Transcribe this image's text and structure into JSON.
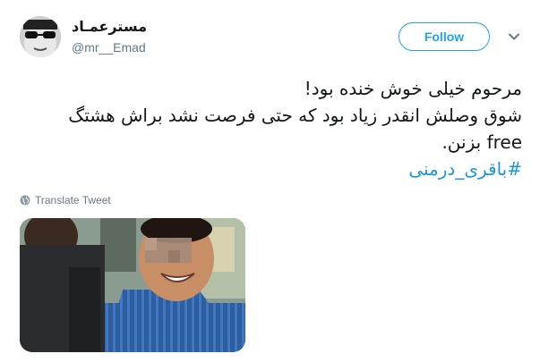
{
  "user": {
    "display_name": "مسترعمـاد",
    "handle": "@mr__Emad"
  },
  "header": {
    "follow_label": "Follow"
  },
  "tweet": {
    "lines": [
      "مرحوم خیلی خوش خنده بود!",
      "شوق وصلش انقدر زیاد بود که حتی فرصت نشد براش هشتگ",
      "free بزنن."
    ],
    "hashtag": "#باقری_درمنی"
  },
  "translate_label": "Translate Tweet",
  "colors": {
    "accent": "#1da1f2",
    "link": "#1b95e0",
    "muted": "#657786"
  },
  "icons": {
    "more": "chevron-down-icon",
    "translate": "globe-icon"
  }
}
